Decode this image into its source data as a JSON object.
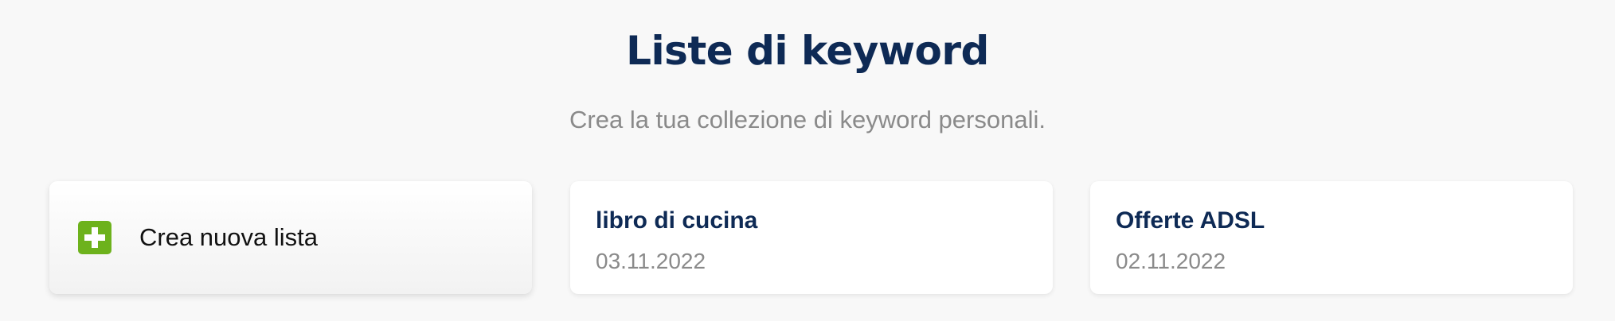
{
  "header": {
    "title": "Liste di keyword",
    "subtitle": "Crea la tua collezione di keyword personali."
  },
  "create_card": {
    "label": "Crea nuova lista",
    "icon": "plus-icon",
    "icon_color": "#6db21c"
  },
  "lists": [
    {
      "name": "libro di cucina",
      "date": "03.11.2022"
    },
    {
      "name": "Offerte ADSL",
      "date": "02.11.2022"
    }
  ],
  "colors": {
    "title": "#0e2a55",
    "muted": "#8a8a8a",
    "background": "#f8f8f8"
  }
}
